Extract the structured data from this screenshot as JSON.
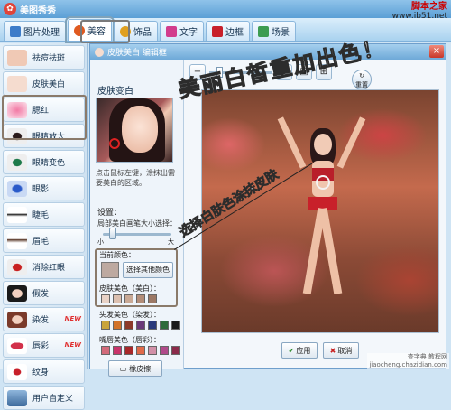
{
  "window": {
    "title": "美图秀秀"
  },
  "watermark_top": {
    "line1": "脚本之家",
    "line2": "www.jb51.net"
  },
  "tabs": [
    {
      "label": "图片处理",
      "color": "#3d7cc9"
    },
    {
      "label": "美容",
      "color": "#e05a20"
    },
    {
      "label": "饰品",
      "color": "#e0a020"
    },
    {
      "label": "文字",
      "color": "#d23c8c"
    },
    {
      "label": "边框",
      "color": "#c8202a"
    },
    {
      "label": "场景",
      "color": "#3d9c50"
    }
  ],
  "left_panel": {
    "items": [
      {
        "label": "祛痘祛斑",
        "icon": "face-thumb"
      },
      {
        "label": "皮肤美白",
        "icon": "face-thumb"
      },
      {
        "label": "腮红",
        "icon": "blush-icon"
      },
      {
        "label": "眼睛放大",
        "icon": "eye-icon"
      },
      {
        "label": "眼睛变色",
        "icon": "eye-color-icon"
      },
      {
        "label": "眼影",
        "icon": "eyeshadow-icon"
      },
      {
        "label": "睫毛",
        "icon": "eyelash-icon"
      },
      {
        "label": "眉毛",
        "icon": "eyebrow-icon"
      },
      {
        "label": "消除红眼",
        "icon": "redeye-icon"
      },
      {
        "label": "假发",
        "icon": "wig-icon"
      },
      {
        "label": "染发",
        "icon": "hair-dye-icon",
        "badge": "NEW"
      },
      {
        "label": "唇彩",
        "icon": "lips-icon",
        "badge": "NEW"
      },
      {
        "label": "纹身",
        "icon": "tattoo-icon"
      },
      {
        "label": "用户自定义",
        "icon": "custom-icon"
      }
    ]
  },
  "dialog": {
    "title": "皮肤美白 编辑框",
    "section_title": "皮肤变白",
    "hint": "点击鼠标左键，涂抹出需要美白的区域。",
    "settings_label": "设置：",
    "brush_label": "局部美白画笔大小选择：",
    "slider_min": "小",
    "slider_max": "大",
    "brush_size_fraction": 0.15,
    "current_color_label": "当前颜色：",
    "pick_other_label": "选择其他颜色",
    "skin_color_label": "皮肤美色（美白）：",
    "hair_color_label": "头发美色（染发）：",
    "lip_color_label": "嘴唇美色（唇彩）：",
    "eraser_label": "橡皮擦",
    "reset_label": "重置",
    "apply_label": "应用",
    "cancel_label": "取消",
    "current_color": "#bda9a0",
    "skin_swatches": [
      "#e8d2c6",
      "#dcc0b0",
      "#c9a995",
      "#b38d78",
      "#9c7865"
    ],
    "hair_swatches": [
      "#c9a43a",
      "#d2732a",
      "#8c3a2a",
      "#6a3a78",
      "#2a3a7a",
      "#2f6a3a",
      "#1a1a1a"
    ],
    "lip_swatches": [
      "#d26a7a",
      "#c9346a",
      "#a8282a",
      "#e06a4a",
      "#d290a8",
      "#b04a8a",
      "#8a2a4a"
    ]
  },
  "annotations": {
    "big": "美丽白皙重加出色！",
    "small": "选择白肤色涂抹皮肤"
  },
  "footer_watermark": {
    "line1": "查字典 教程网",
    "line2": "jiaocheng.chazidian.com"
  }
}
